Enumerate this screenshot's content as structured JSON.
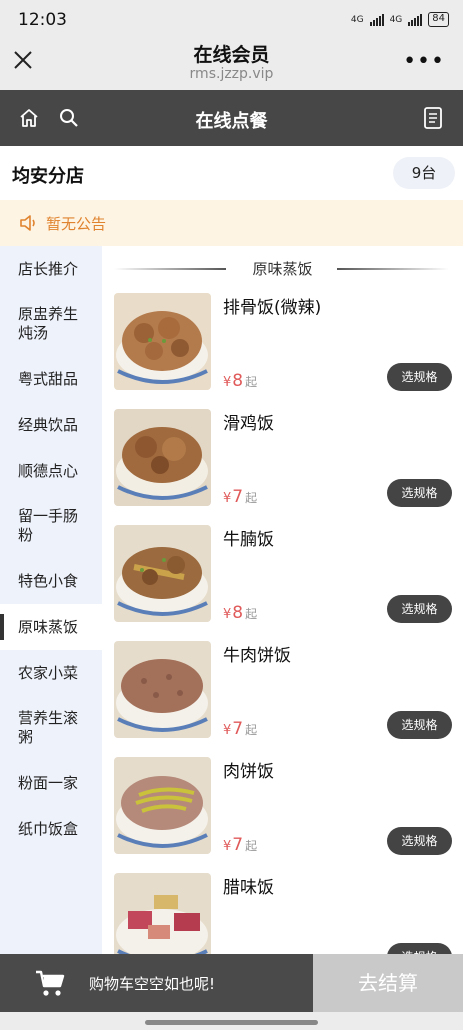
{
  "status_bar": {
    "time": "12:03",
    "network1": "4G",
    "network2": "4G",
    "battery": "84"
  },
  "wechat": {
    "title": "在线会员",
    "url": "rms.jzzp.vip"
  },
  "app_bar": {
    "title": "在线点餐"
  },
  "shop": {
    "name": "均安分店",
    "table": "9台"
  },
  "notice": {
    "text": "暂无公告"
  },
  "sidebar": {
    "items": [
      {
        "label": "店长推介"
      },
      {
        "label": "原盅养生\n炖汤"
      },
      {
        "label": "粤式甜品"
      },
      {
        "label": "经典饮品"
      },
      {
        "label": "顺德点心"
      },
      {
        "label": "留一手肠\n粉"
      },
      {
        "label": "特色小食"
      },
      {
        "label": "原味蒸饭",
        "active": true
      },
      {
        "label": "农家小菜"
      },
      {
        "label": "营养生滚\n粥"
      },
      {
        "label": "粉面一家"
      },
      {
        "label": "纸巾饭盒"
      }
    ]
  },
  "section": {
    "title": "原味蒸饭"
  },
  "dishes": [
    {
      "name": "排骨饭(微辣)",
      "currency": "¥",
      "price": "8",
      "suffix": "起",
      "button": "选规格"
    },
    {
      "name": "滑鸡饭",
      "currency": "¥",
      "price": "7",
      "suffix": "起",
      "button": "选规格"
    },
    {
      "name": "牛腩饭",
      "currency": "¥",
      "price": "8",
      "suffix": "起",
      "button": "选规格"
    },
    {
      "name": "牛肉饼饭",
      "currency": "¥",
      "price": "7",
      "suffix": "起",
      "button": "选规格"
    },
    {
      "name": "肉饼饭",
      "currency": "¥",
      "price": "7",
      "suffix": "起",
      "button": "选规格"
    },
    {
      "name": "腊味饭",
      "currency": "¥",
      "price": "",
      "suffix": "",
      "button": "选规格"
    }
  ],
  "cart": {
    "text": "购物车空空如也呢!",
    "checkout": "去结算"
  },
  "icons": {
    "close": "close-icon",
    "more": "more-icon",
    "home": "home-icon",
    "search": "search-icon",
    "menu_doc": "document-icon",
    "notice": "speaker-icon",
    "cart": "cart-icon"
  },
  "colors": {
    "app_bar": "#474747",
    "accent_price": "#e05a5a",
    "notice_text": "#e0832f",
    "sidebar_bg": "#eef2fb"
  }
}
